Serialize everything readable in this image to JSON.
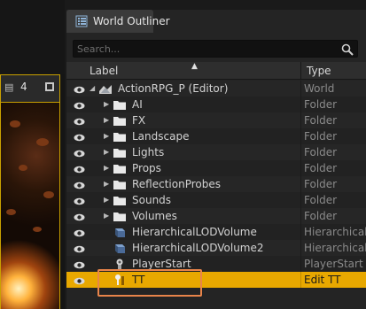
{
  "viewport": {
    "camera_speed": "4"
  },
  "panel": {
    "tab_title": "World Outliner",
    "search": {
      "placeholder": "Search..."
    },
    "columns": {
      "label": "Label",
      "type": "Type"
    }
  },
  "rows": [
    {
      "label": "ActionRPG_P (Editor)",
      "type": "World",
      "icon": "world-icon",
      "indent": 0,
      "expandable": false
    },
    {
      "label": "AI",
      "type": "Folder",
      "icon": "folder-icon",
      "indent": 1,
      "expandable": true
    },
    {
      "label": "FX",
      "type": "Folder",
      "icon": "folder-icon",
      "indent": 1,
      "expandable": true
    },
    {
      "label": "Landscape",
      "type": "Folder",
      "icon": "folder-icon",
      "indent": 1,
      "expandable": true
    },
    {
      "label": "Lights",
      "type": "Folder",
      "icon": "folder-icon",
      "indent": 1,
      "expandable": true
    },
    {
      "label": "Props",
      "type": "Folder",
      "icon": "folder-icon",
      "indent": 1,
      "expandable": true
    },
    {
      "label": "ReflectionProbes",
      "type": "Folder",
      "icon": "folder-icon",
      "indent": 1,
      "expandable": true
    },
    {
      "label": "Sounds",
      "type": "Folder",
      "icon": "folder-icon",
      "indent": 1,
      "expandable": true
    },
    {
      "label": "Volumes",
      "type": "Folder",
      "icon": "folder-icon",
      "indent": 1,
      "expandable": true
    },
    {
      "label": "HierarchicalLODVolume",
      "type": "HierarchicalL",
      "icon": "cube-icon",
      "indent": 1,
      "expandable": false
    },
    {
      "label": "HierarchicalLODVolume2",
      "type": "HierarchicalL",
      "icon": "cube-icon",
      "indent": 1,
      "expandable": false
    },
    {
      "label": "PlayerStart",
      "type": "PlayerStart",
      "icon": "player-start-icon",
      "indent": 1,
      "expandable": false
    },
    {
      "label": "TT",
      "type": "Edit TT",
      "icon": "actor-pin-icon",
      "indent": 1,
      "expandable": false,
      "selected": true
    }
  ],
  "colors": {
    "selection": "#e8a800",
    "highlight_box": "#e8844a",
    "viewport_border": "#c9a000"
  }
}
